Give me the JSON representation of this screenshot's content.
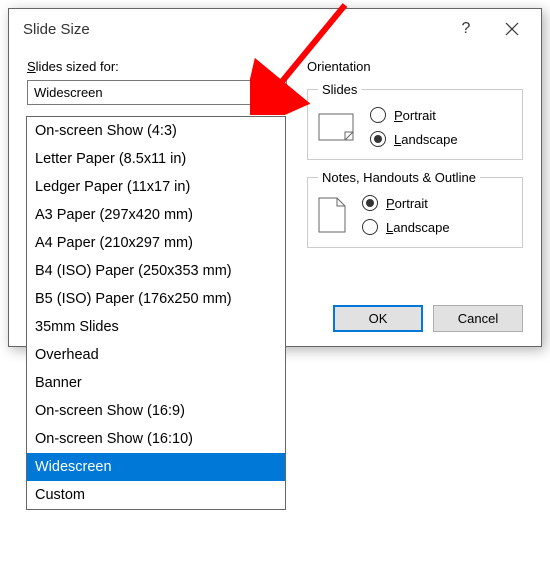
{
  "dialog": {
    "title": "Slide Size",
    "help_tooltip": "Help",
    "close_tooltip": "Close"
  },
  "left": {
    "label_prefix": "S",
    "label_rest": "lides sized for:",
    "combo_value": "Widescreen"
  },
  "right": {
    "heading": "Orientation",
    "group1": {
      "legend": "Slides",
      "portrait_prefix": "P",
      "portrait_rest": "ortrait",
      "landscape_prefix": "L",
      "landscape_rest": "andscape",
      "selected": "landscape"
    },
    "group2": {
      "legend": "Notes, Handouts & Outline",
      "portrait_prefix": "P",
      "portrait_rest": "ortrait",
      "landscape_prefix": "L",
      "landscape_rest": "andscape",
      "selected": "portrait"
    }
  },
  "buttons": {
    "ok": "OK",
    "cancel": "Cancel"
  },
  "dropdown": {
    "items": [
      "On-screen Show (4:3)",
      "Letter Paper (8.5x11 in)",
      "Ledger Paper (11x17 in)",
      "A3 Paper (297x420 mm)",
      "A4 Paper (210x297 mm)",
      "B4 (ISO) Paper (250x353 mm)",
      "B5 (ISO) Paper (176x250 mm)",
      "35mm Slides",
      "Overhead",
      "Banner",
      "On-screen Show (16:9)",
      "On-screen Show (16:10)",
      "Widescreen",
      "Custom"
    ],
    "selected_index": 12
  }
}
